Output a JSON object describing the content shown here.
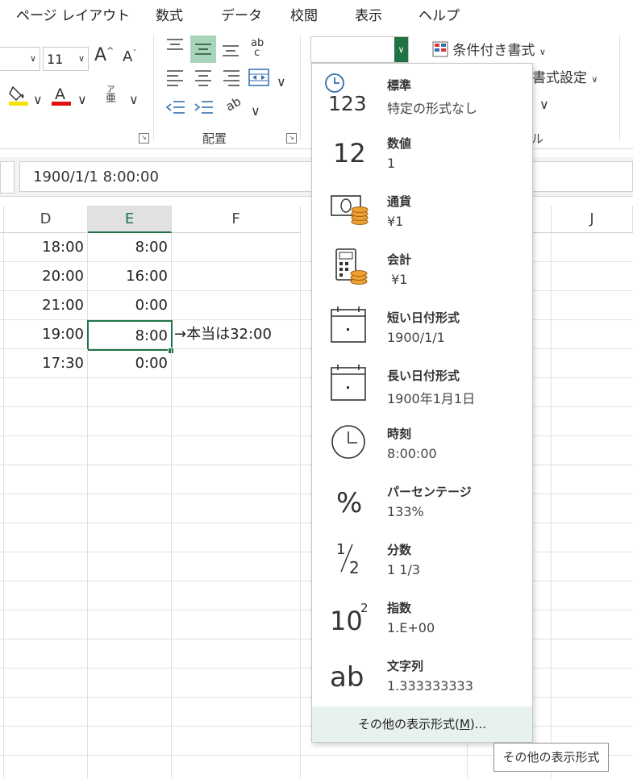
{
  "tabs": [
    "ページ レイアウト",
    "数式",
    "データ",
    "校閲",
    "表示",
    "ヘルプ"
  ],
  "font": {
    "size": "11",
    "grow_icon": "font-grow-icon",
    "shrink_icon": "font-shrink-icon",
    "fill_color": "#f5e100",
    "font_color": "#e01010",
    "phonetic_icon": "phonetic-guide-icon"
  },
  "alignment": {
    "group_label": "配置",
    "wrap_text_glyph": "ab",
    "selected_color": "#a8d5b9"
  },
  "number_format": {
    "current_value": "",
    "accent": "#217346"
  },
  "styles": {
    "conditional_formatting": "条件付き書式",
    "format_as_table_fragment": "書式設定",
    "group_fragment": "ル"
  },
  "formula_bar": {
    "value": "1900/1/1  8:00:00"
  },
  "columns": [
    {
      "id": "D",
      "label": "D"
    },
    {
      "id": "E",
      "label": "E"
    },
    {
      "id": "F",
      "label": "F"
    },
    {
      "id": "J",
      "label": "J"
    }
  ],
  "rows": [
    {
      "d": "18:00",
      "e": "8:00",
      "f": ""
    },
    {
      "d": "20:00",
      "e": "16:00",
      "f": ""
    },
    {
      "d": "21:00",
      "e": "0:00",
      "f": ""
    },
    {
      "d": "19:00",
      "e": "8:00",
      "f": "→本当は32:00"
    },
    {
      "d": "17:30",
      "e": "0:00",
      "f": ""
    }
  ],
  "menu": {
    "items": [
      {
        "title": "標準",
        "value": "特定の形式なし",
        "icon": "general-clock-123-icon",
        "glyph": "123"
      },
      {
        "title": "数値",
        "value": "1",
        "icon": "number-icon",
        "glyph": "12"
      },
      {
        "title": "通貨",
        "value": "¥1",
        "icon": "currency-icon",
        "glyph": ""
      },
      {
        "title": "会計",
        "value": " ¥1",
        "icon": "accounting-icon",
        "glyph": ""
      },
      {
        "title": "短い日付形式",
        "value": "1900/1/1",
        "icon": "short-date-calendar-icon",
        "glyph": ""
      },
      {
        "title": "長い日付形式",
        "value": "1900年1月1日",
        "icon": "long-date-calendar-icon",
        "glyph": ""
      },
      {
        "title": "時刻",
        "value": "8:00:00",
        "icon": "time-clock-icon",
        "glyph": ""
      },
      {
        "title": "パーセンテージ",
        "value": "133%",
        "icon": "percent-icon",
        "glyph": "%"
      },
      {
        "title": "分数",
        "value": "1 1/3",
        "icon": "fraction-icon",
        "glyph": "½"
      },
      {
        "title": "指数",
        "value": "1.E+00",
        "icon": "scientific-icon",
        "glyph": "10"
      },
      {
        "title": "文字列",
        "value": "1.333333333",
        "icon": "text-icon",
        "glyph": "ab"
      }
    ],
    "more_pre": "その他の表示形式(",
    "more_key": "M",
    "more_post": ")...",
    "coin_color": "#f0a030"
  },
  "tooltip": "その他の表示形式"
}
